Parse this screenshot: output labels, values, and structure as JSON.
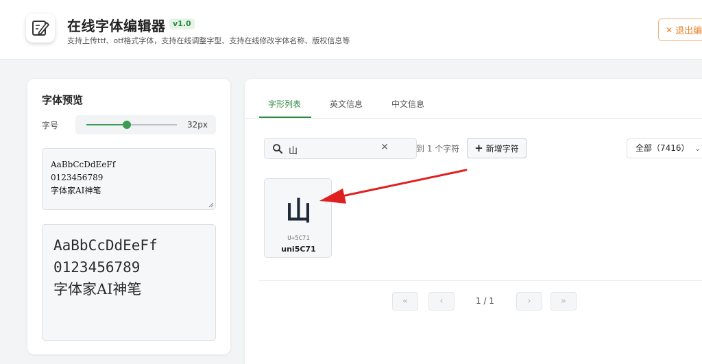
{
  "header": {
    "title": "在线字体编辑器",
    "version": "v1.0",
    "subtitle": "支持上传ttf、otf格式字体，支持在线调整字型、支持在线修改字体名称、版权信息等",
    "exit_label": "退出编"
  },
  "preview_panel": {
    "title": "字体预览",
    "size_label": "字号",
    "size_value": "32px",
    "size_fraction": 0.45,
    "input_lines": [
      "AaBbCcDdEeFf",
      "0123456789",
      "字体家AI神笔"
    ],
    "render_lines": [
      "AaBbCcDdEeFf",
      "0123456789",
      "字体家AI神笔"
    ]
  },
  "glyph_panel": {
    "tabs": [
      {
        "label": "字形列表",
        "active": true
      },
      {
        "label": "英文信息",
        "active": false
      },
      {
        "label": "中文信息",
        "active": false
      }
    ],
    "search": {
      "value": "山",
      "clear_icon": "close-icon"
    },
    "result_count": "到 1 个字符",
    "add_glyph_label": "新增字符",
    "filter_value": "全部（7416）",
    "glyphs": [
      {
        "char": "山",
        "code": "U+5C71",
        "name": "uni5C71"
      }
    ],
    "pager": {
      "first": "«",
      "prev": "‹",
      "indicator": "1 / 1",
      "next": "›",
      "last": "»"
    }
  },
  "colors": {
    "accent": "#2f8a43",
    "exit": "#e67e22",
    "annotation_arrow": "#e02020"
  }
}
